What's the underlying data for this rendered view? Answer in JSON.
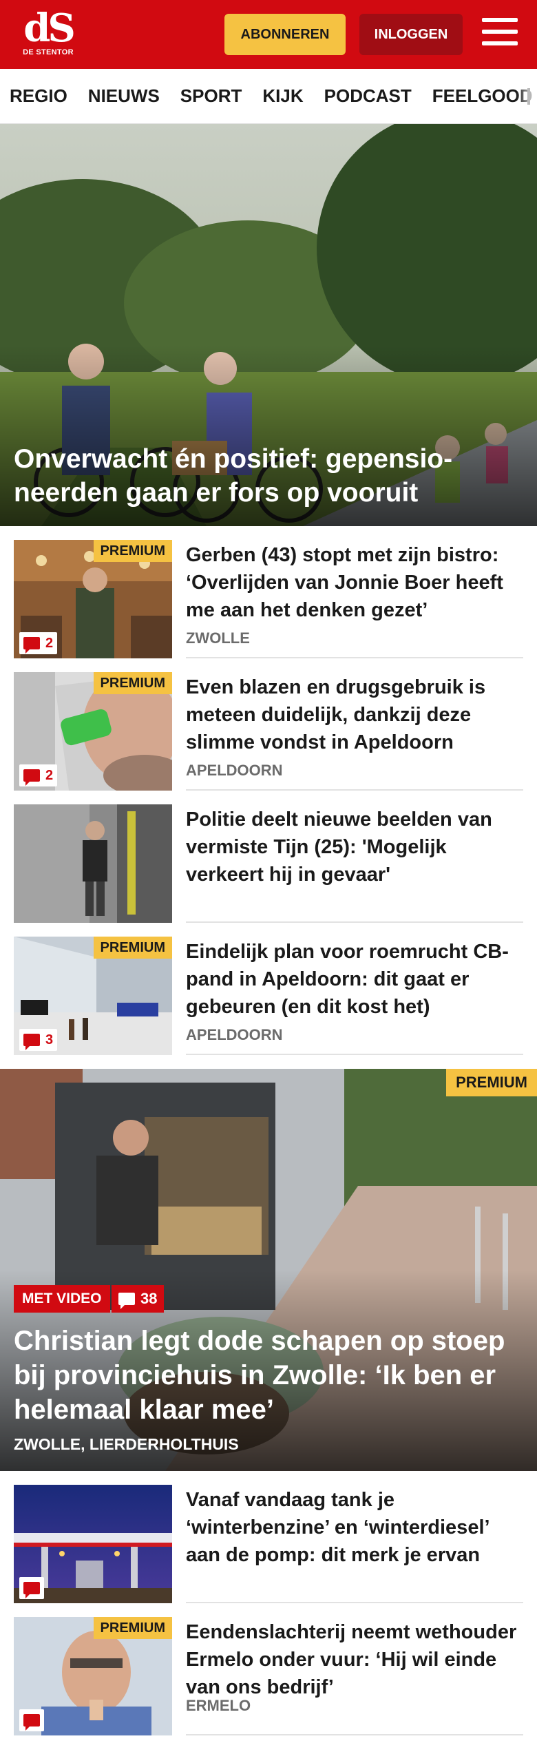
{
  "header": {
    "logo_mark": "dS",
    "logo_sub": "DE STENTOR",
    "subscribe_label": "ABONNEREN",
    "login_label": "INLOGGEN"
  },
  "nav": {
    "items": [
      "REGIO",
      "NIEUWS",
      "SPORT",
      "KIJK",
      "PODCAST",
      "FEELGOOD"
    ]
  },
  "hero": {
    "headline": "Onverwacht én positief: gepensio­neerden gaan er fors op vooruit"
  },
  "articles": [
    {
      "title": "Gerben (43) stopt met zijn bistro: ‘Overlijden van Jonnie Boer heeft me aan het denken gezet’",
      "location": "ZWOLLE",
      "premium": "PREMIUM",
      "comments": "2"
    },
    {
      "title": "Even blazen en drugsgebruik is meteen duidelijk, dankzij deze slimme vondst in Apeldoorn",
      "location": "APELDOORN",
      "premium": "PREMIUM",
      "comments": "2"
    },
    {
      "title": "Politie deelt nieuwe beelden van vermiste Tijn (25): 'Mogelijk verkeert hij in gevaar'"
    },
    {
      "title": "Eindelijk plan voor roemrucht CB-pand in Apeldoorn: dit gaat er gebeuren (en dit kost het)",
      "location": "APELDOORN",
      "premium": "PREMIUM",
      "comments": "3"
    }
  ],
  "feature": {
    "premium": "PREMIUM",
    "video_label": "MET VIDEO",
    "comments": "38",
    "headline": "Christian legt dode schapen op stoep bij provinciehuis in Zwolle: ‘Ik ben er helemaal klaar mee’",
    "location": "ZWOLLE, LIERDERHOLTHUIS"
  },
  "articles2": [
    {
      "title": "Vanaf vandaag tank je ‘winterbenzine’ en ‘winterdiesel’ aan de pomp: dit merk je ervan"
    },
    {
      "title": "Eendenslachterij neemt wethouder Ermelo onder vuur: ‘Hij wil einde van ons bedrijf’",
      "location": "ERMELO",
      "premium": "PREMIUM"
    }
  ],
  "colors": {
    "brand": "#d10a11",
    "premium": "#f5c242",
    "muted": "#6b6b6b"
  }
}
